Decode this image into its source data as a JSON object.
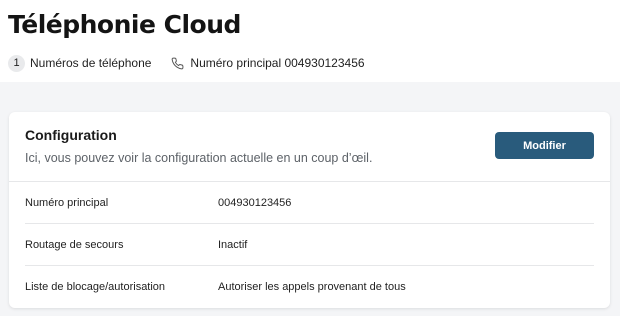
{
  "header": {
    "title": "Téléphonie Cloud",
    "phone_numbers_count": "1",
    "phone_numbers_label": "Numéros de téléphone",
    "main_number_label": "Numéro principal 004930123456"
  },
  "configuration": {
    "title": "Configuration",
    "subtitle": "Ici, vous pouvez voir la configuration actuelle en un coup d’œil.",
    "edit_label": "Modifier",
    "rows": [
      {
        "label": "Numéro principal",
        "value": "004930123456"
      },
      {
        "label": "Routage de secours",
        "value": "Inactif"
      },
      {
        "label": "Liste de blocage/autorisation",
        "value": "Autoriser les appels provenant de tous"
      }
    ]
  },
  "colors": {
    "accent": "#295b7c",
    "background": "#f4f5f7",
    "badge": "#e9eaec"
  },
  "icons": {
    "main_number": "phone-icon"
  }
}
